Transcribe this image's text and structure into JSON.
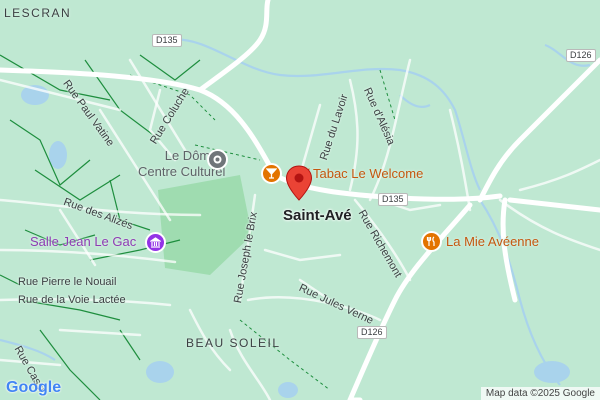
{
  "areas": {
    "lescran": "LESCRAN",
    "beau_soleil": "BEAU SOLEIL",
    "town": "Saint-Avé"
  },
  "roads": {
    "d135_top": "D135",
    "d135_mid": "D135",
    "d126_right": "D126",
    "d126_bottom": "D126"
  },
  "streets": {
    "paul_vatine": "Rue Paul Vatine",
    "coluche": "Rue Coluche",
    "du_lavoir": "Rue du Lavoir",
    "d_alesia": "Rue d'Alésia",
    "des_alizes": "Rue des Alizés",
    "joseph_le_brix": "Rue Joseph le Brix",
    "richemont": "Rue Richemont",
    "pierre_le_nouail": "Rue Pierre le Nouail",
    "de_la_voie_lactee": "Rue de la Voie Lactée",
    "jules_verne": "Rue Jules Verne",
    "cassin": "Rue Cassi"
  },
  "pois": {
    "le_dome_line1": "Le Dôme -",
    "le_dome_line2": "Centre Culturel",
    "tabac": "/ Tabac Le Welcome",
    "salle": "Salle Jean Le Gac",
    "boulangerie": "La Mie Avéenne"
  },
  "icons": {
    "cultural": "museum-icon",
    "bar": "cocktail-icon",
    "hall": "building-icon",
    "bakery": "restaurant-icon",
    "marker": "location-pin-icon"
  },
  "colors": {
    "land": "#bfe8d2",
    "road": "#ffffff",
    "water": "#a9d3ec",
    "path": "#1e8e3e",
    "pin": "#ea4335",
    "poi_orange": "#e37400",
    "poi_purple": "#9334e6",
    "poi_grey": "#70757a"
  },
  "footer": {
    "attribution": "Map data ©2025 Google",
    "logo": "Google"
  }
}
